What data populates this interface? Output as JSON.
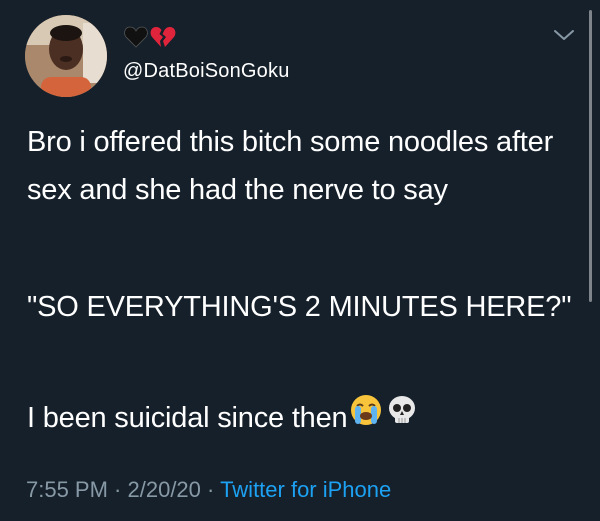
{
  "user": {
    "handle": "@DatBoiSonGoku",
    "name_icons": [
      "black-heart-icon",
      "broken-heart-icon"
    ]
  },
  "tweet": {
    "paragraph_1": "Bro i offered this bitch some noodles after sex and she had the nerve to say",
    "paragraph_2": "\"SO EVERYTHING'S 2 MINUTES HERE?\"",
    "paragraph_3": "I been suicidal since then",
    "paragraph_3_icons": [
      "loudly-crying-face-icon",
      "skull-icon"
    ]
  },
  "meta": {
    "time": "7:55 PM",
    "separator_1": " · ",
    "date": "2/20/20",
    "separator_2": " · ",
    "source": "Twitter for iPhone"
  },
  "colors": {
    "background": "#15202b",
    "text": "#ffffff",
    "muted": "#8899a6",
    "link": "#1da1f2"
  }
}
